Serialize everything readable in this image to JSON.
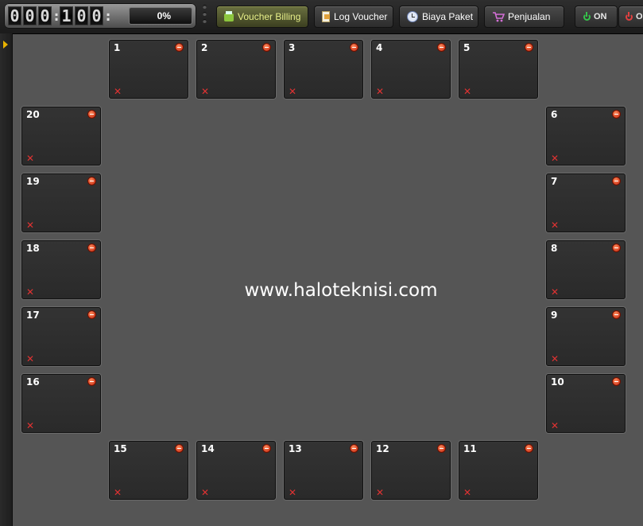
{
  "counter": {
    "digits": [
      "0",
      "0",
      "0",
      ":",
      "1",
      "0",
      "0",
      ":"
    ],
    "progress": "0%"
  },
  "toolbar": {
    "voucher_billing": "Voucher Billing",
    "log_voucher": "Log Voucher",
    "biaya_paket": "Biaya Paket",
    "penjualan": "Penjualan",
    "on": "ON",
    "off": "O"
  },
  "accent_colors": {
    "active_button_text": "#e8f08a",
    "power_on": "#35c24a",
    "power_off": "#e04040",
    "pc_close": "#e03232"
  },
  "clients": [
    {
      "n": "1"
    },
    {
      "n": "2"
    },
    {
      "n": "3"
    },
    {
      "n": "4"
    },
    {
      "n": "5"
    },
    {
      "n": "6"
    },
    {
      "n": "7"
    },
    {
      "n": "8"
    },
    {
      "n": "9"
    },
    {
      "n": "10"
    },
    {
      "n": "11"
    },
    {
      "n": "12"
    },
    {
      "n": "13"
    },
    {
      "n": "14"
    },
    {
      "n": "15"
    },
    {
      "n": "16"
    },
    {
      "n": "17"
    },
    {
      "n": "18"
    },
    {
      "n": "19"
    },
    {
      "n": "20"
    }
  ],
  "close_glyph": "✕",
  "watermark": "www.haloteknisi.com"
}
